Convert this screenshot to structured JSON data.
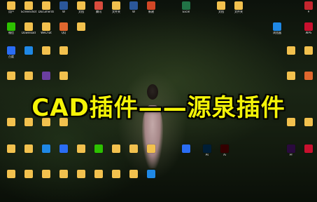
{
  "overlay_title": "CAD插件——源泉插件",
  "icons": [
    {
      "label": "用户",
      "color": "#f2c14e"
    },
    {
      "label": "Screenshot",
      "color": "#f2c14e"
    },
    {
      "label": "Documents",
      "color": "#f2c14e"
    },
    {
      "label": "W",
      "color": "#2b579a"
    },
    {
      "label": "文档",
      "color": "#f2c14e"
    },
    {
      "label": "腾讯",
      "color": "#d94c3d"
    },
    {
      "label": "文件夹",
      "color": "#f2c14e"
    },
    {
      "label": "W",
      "color": "#2b579a"
    },
    {
      "label": "新建",
      "color": "#d24726"
    },
    {
      "label": "Excel",
      "color": "#217346"
    },
    {
      "label": "文档",
      "color": "#f2c14e"
    },
    {
      "label": "文件夹",
      "color": "#f2c14e"
    },
    {
      "label": "A",
      "color": "#c4262e"
    },
    {
      "label": "微信",
      "color": "#2dc100"
    },
    {
      "label": "Download",
      "color": "#f2c14e"
    },
    {
      "label": "WeChat",
      "color": "#f2c14e"
    },
    {
      "label": "QQ",
      "color": "#e0672e"
    },
    {
      "label": "",
      "color": "#f2c14e"
    },
    {
      "label": "浏览器",
      "color": "#1f88e5"
    },
    {
      "label": "WPS",
      "color": "#c8102e"
    },
    {
      "label": "百度",
      "color": "#2a6df4"
    },
    {
      "label": "",
      "color": "#1f88e5"
    },
    {
      "label": "",
      "color": "#f2c14e"
    },
    {
      "label": "",
      "color": "#f2c14e"
    },
    {
      "label": "",
      "color": "#f2c14e"
    },
    {
      "label": "",
      "color": "#f2c14e"
    },
    {
      "label": "",
      "color": "#f2c14e"
    },
    {
      "label": "",
      "color": "#f2c14e"
    },
    {
      "label": "",
      "color": "#6b3fa0"
    },
    {
      "label": "",
      "color": "#f2c14e"
    },
    {
      "label": "",
      "color": "#f2c14e"
    },
    {
      "label": "",
      "color": "#e0672e"
    },
    {
      "label": "",
      "color": "#f2c14e"
    },
    {
      "label": "",
      "color": "#f2c14e"
    },
    {
      "label": "",
      "color": "#f2c14e"
    },
    {
      "label": "",
      "color": "#f2c14e"
    },
    {
      "label": "",
      "color": "#f2c14e"
    },
    {
      "label": "",
      "color": "#f2c14e"
    },
    {
      "label": "",
      "color": "#f2c14e"
    },
    {
      "label": "",
      "color": "#f2c14e"
    },
    {
      "label": "",
      "color": "#1f88e5"
    },
    {
      "label": "",
      "color": "#2a6df4"
    },
    {
      "label": "",
      "color": "#f2c14e"
    },
    {
      "label": "",
      "color": "#2dc100"
    },
    {
      "label": "",
      "color": "#f2c14e"
    },
    {
      "label": "",
      "color": "#f2c14e"
    },
    {
      "label": "",
      "color": "#f2c14e"
    },
    {
      "label": "",
      "color": "#2a6df4"
    },
    {
      "label": "Ps",
      "color": "#001e36"
    },
    {
      "label": "Ai",
      "color": "#330000"
    },
    {
      "label": "Pr",
      "color": "#2a0a3d"
    },
    {
      "label": "",
      "color": "#c8102e"
    },
    {
      "label": "",
      "color": "#f2c14e"
    },
    {
      "label": "",
      "color": "#f2c14e"
    },
    {
      "label": "",
      "color": "#f2c14e"
    },
    {
      "label": "",
      "color": "#f2c14e"
    },
    {
      "label": "",
      "color": "#f2c14e"
    },
    {
      "label": "",
      "color": "#f2c14e"
    },
    {
      "label": "",
      "color": "#f2c14e"
    },
    {
      "label": "",
      "color": "#f2c14e"
    },
    {
      "label": "",
      "color": "#1f88e5"
    }
  ]
}
